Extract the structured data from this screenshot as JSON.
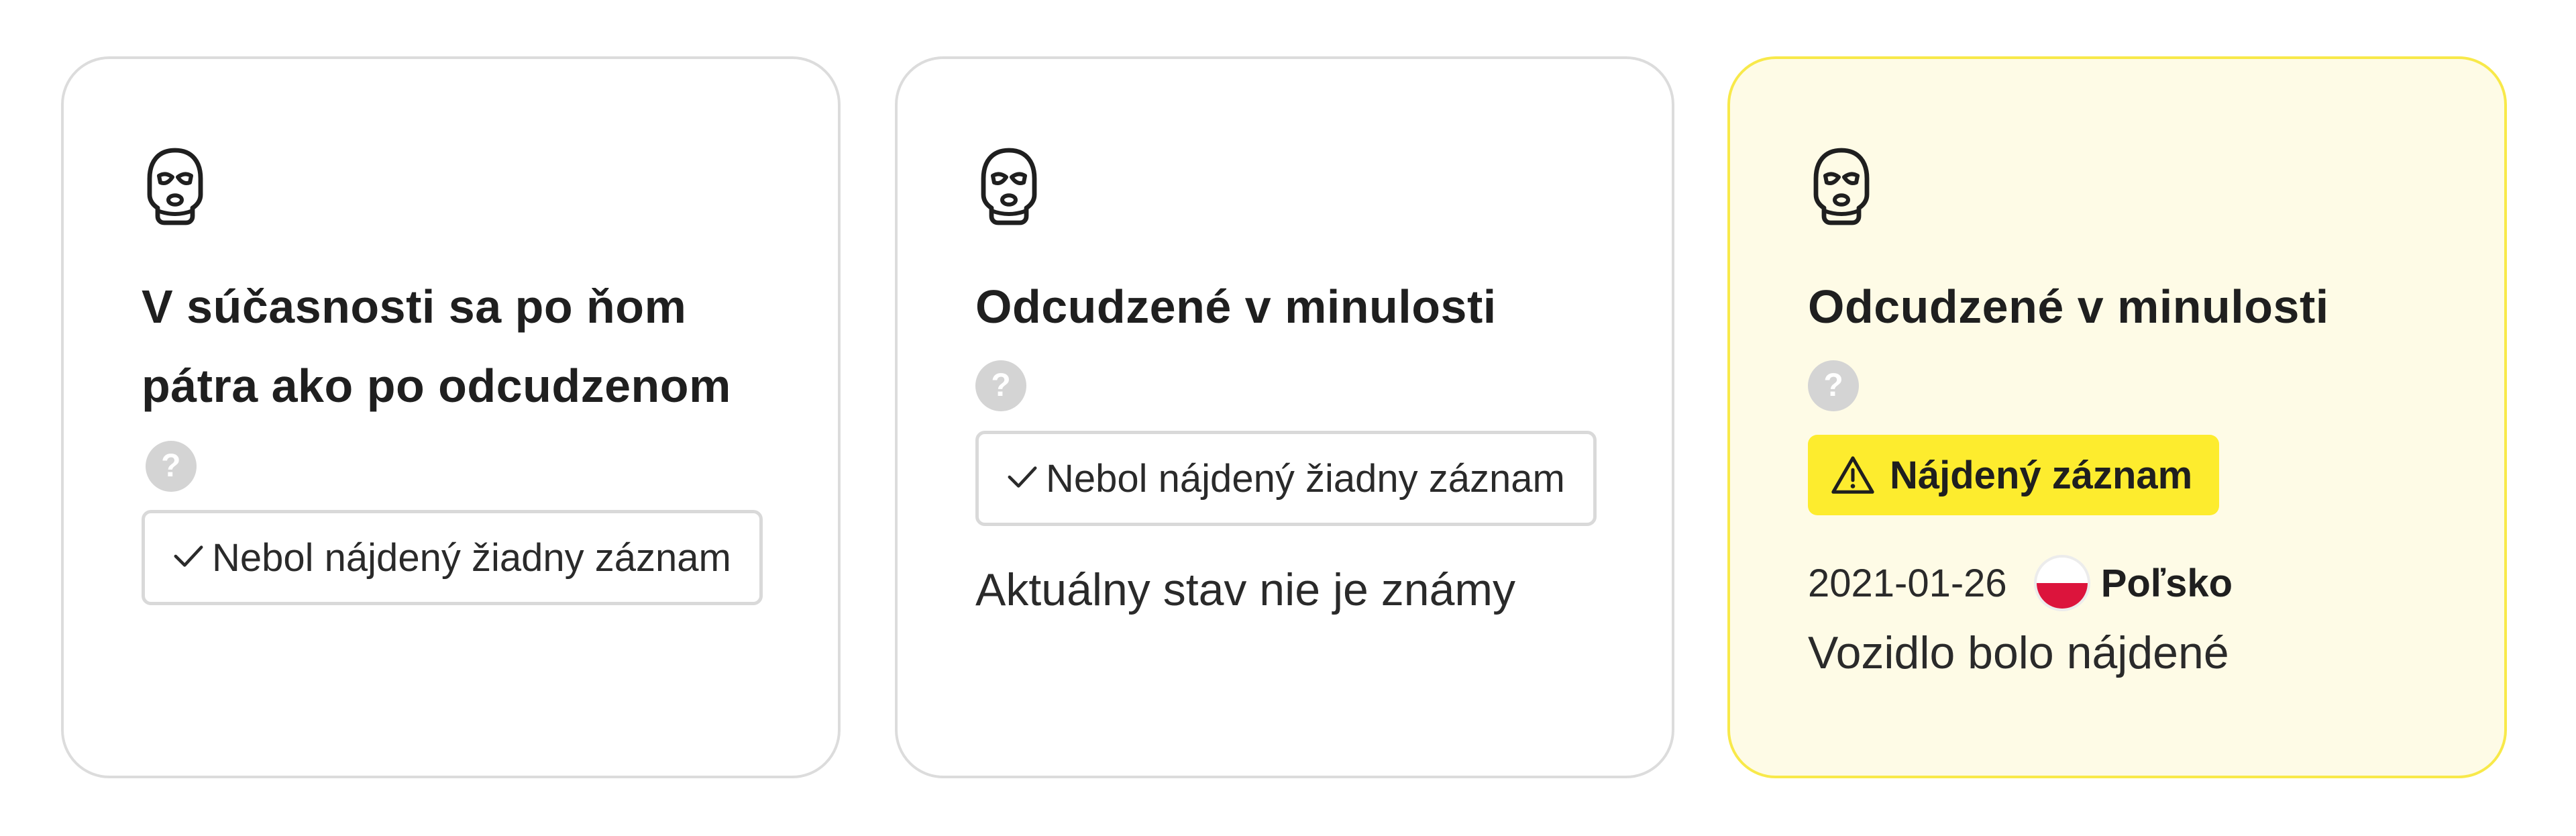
{
  "cards": [
    {
      "icon": "balaclava-icon",
      "title": "V súčasnosti sa po ňom pátra ako po odcudzenom",
      "result": "Nebol nájdený žiadny záznam"
    },
    {
      "icon": "balaclava-icon",
      "title": "Odcudzené v minulosti",
      "result": "Nebol nájdený žiadny záznam",
      "status": "Aktuálny stav nie je známy"
    },
    {
      "icon": "balaclava-icon",
      "title": "Odcudzené v minulosti",
      "badge": "Nájdený záznam",
      "date": "2021-01-26",
      "country": "Poľsko",
      "status": "Vozidlo bolo nájdené"
    }
  ],
  "help_label": "?",
  "icons": {
    "help": "question-icon",
    "check": "check-icon",
    "warning": "warning-icon",
    "flag": "poland-flag-icon"
  },
  "colors": {
    "card_border": "#dcdcdc",
    "highlight_background": "#fefbe6",
    "highlight_border": "#f8e94a",
    "badge_yellow": "#fdec2e",
    "help_grey": "#d4d4d4",
    "flag_red": "#dc143c"
  }
}
